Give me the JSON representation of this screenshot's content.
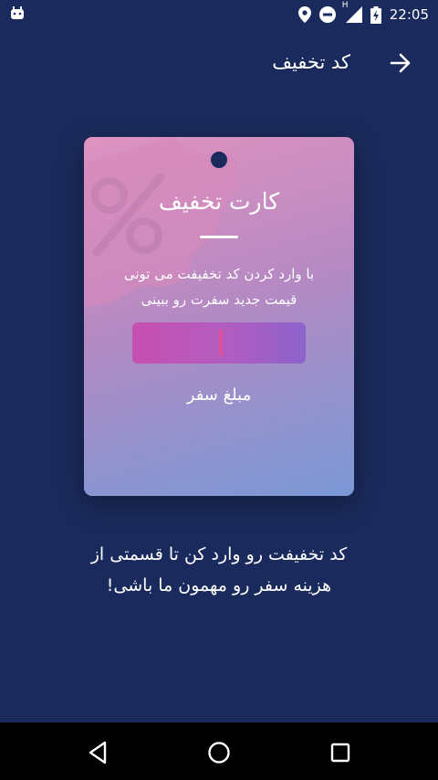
{
  "status_bar": {
    "time": "22:05",
    "network_label": "H",
    "icons": [
      "android-icon",
      "location-icon",
      "dnd-icon",
      "signal-icon",
      "battery-icon"
    ]
  },
  "header": {
    "title": "کد تخفیف",
    "back_icon": "arrow-right-icon"
  },
  "card": {
    "title": "کارت تخفیف",
    "description_line1": "با وارد کردن کد تخفیفت می تونی",
    "description_line2": "قیمت جدید سفرت رو ببینی",
    "price_label": "مبلغ سفر"
  },
  "prompt": {
    "line1": "کد تخفیفت رو وارد کن تا قسمتی از",
    "line2": "هزینه سفر رو مهمون ما باشی!"
  },
  "nav": {
    "icons": [
      "back-triangle-icon",
      "home-circle-icon",
      "recents-square-icon"
    ]
  },
  "colors": {
    "background": "#1b2a5c",
    "card_start": "#df93c0",
    "card_end": "#7b98d6",
    "price_bar": "#c74fb0"
  }
}
